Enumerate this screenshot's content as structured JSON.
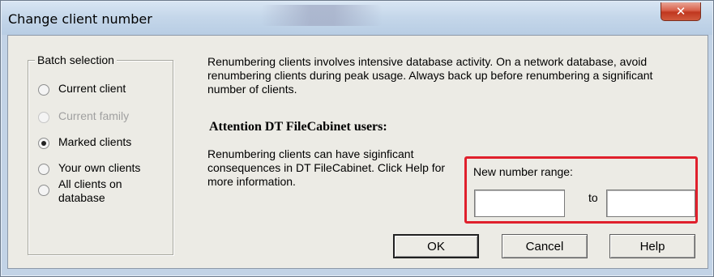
{
  "window": {
    "title": "Change client number",
    "title_background_fragment": "abc",
    "close_glyph": "✕"
  },
  "batch_selection": {
    "legend": "Batch selection",
    "options": [
      {
        "label": "Current client",
        "checked": false,
        "enabled": true
      },
      {
        "label": "Current family",
        "checked": false,
        "enabled": false
      },
      {
        "label": "Marked clients",
        "checked": true,
        "enabled": true
      },
      {
        "label": "Your own clients",
        "checked": false,
        "enabled": true
      },
      {
        "label": "All clients on database",
        "checked": false,
        "enabled": true
      }
    ]
  },
  "info": {
    "paragraph": "Renumbering clients involves intensive database activity. On a network database, avoid renumbering clients during peak usage. Always back up before renumbering a significant number of clients.",
    "attention_heading": "Attention DT FileCabinet users:",
    "consequence_text": "Renumbering clients can have siginficant consequences in DT FileCabinet. Click Help for more information."
  },
  "range": {
    "label": "New number range:",
    "from_value": "",
    "to_label": "to",
    "to_value": ""
  },
  "buttons": {
    "ok": "OK",
    "cancel": "Cancel",
    "help": "Help"
  },
  "colors": {
    "highlight": "#e0202c",
    "close_button": "#c0371f"
  }
}
